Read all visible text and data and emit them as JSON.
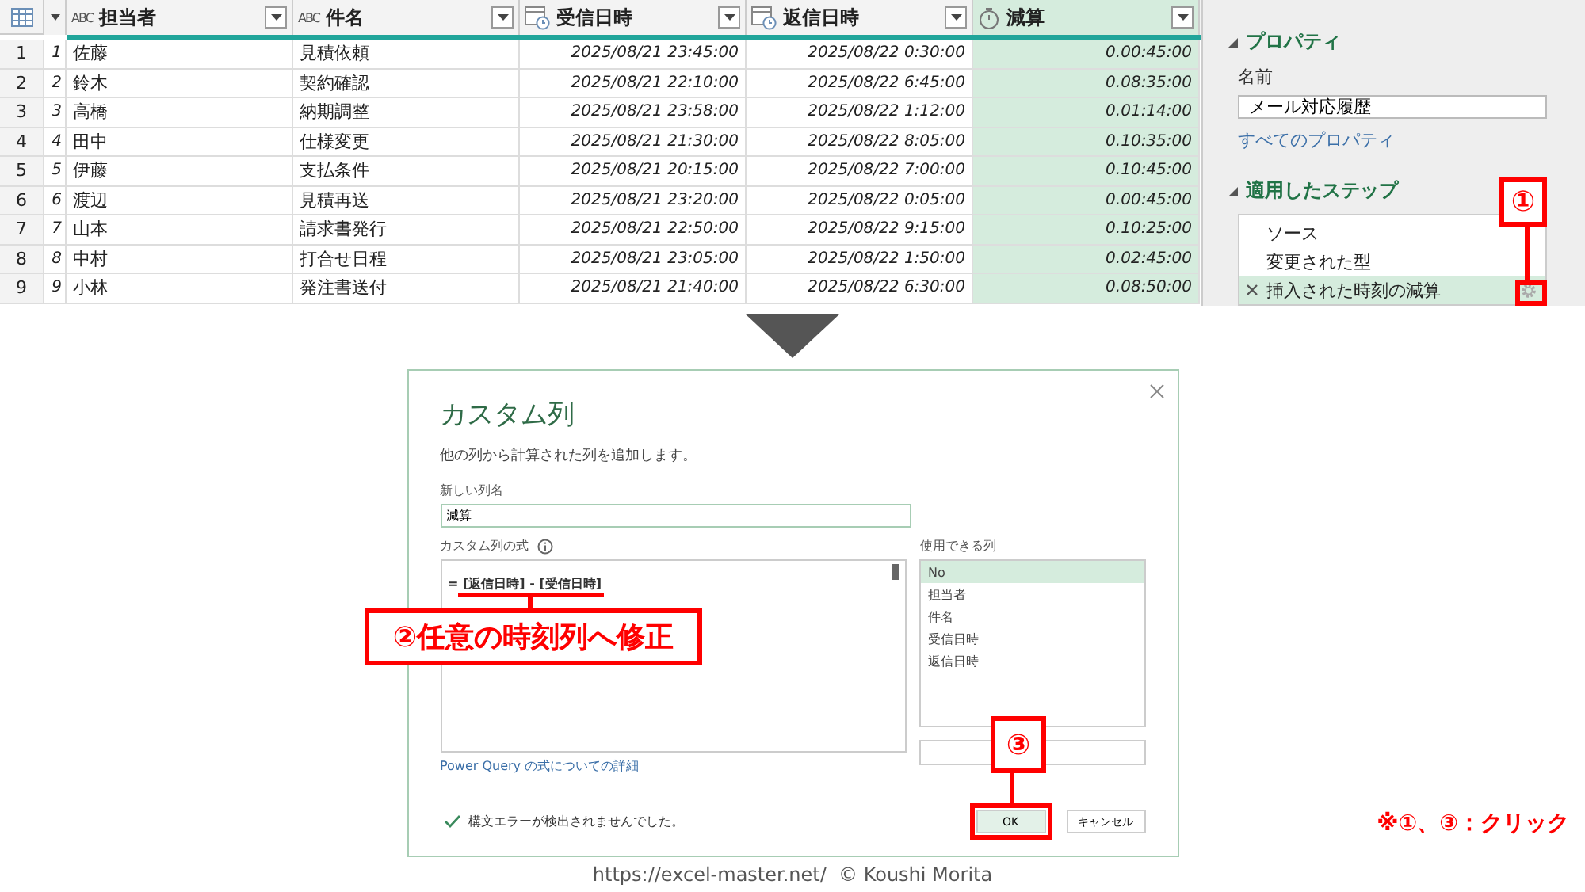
{
  "grid": {
    "columns": [
      {
        "kind": "text",
        "type_glyph": "ABC",
        "label": "担当者",
        "selected": false
      },
      {
        "kind": "text",
        "type_glyph": "ABC",
        "label": "件名",
        "selected": false
      },
      {
        "kind": "datetime",
        "label": "受信日時",
        "selected": false
      },
      {
        "kind": "datetime",
        "label": "返信日時",
        "selected": false
      },
      {
        "kind": "duration",
        "label": "減算",
        "selected": true
      }
    ],
    "rows": [
      {
        "row_number": "1",
        "index": "1",
        "cells": [
          "佐藤",
          "見積依頼",
          "2025/08/21 23:45:00",
          "2025/08/22 0:30:00",
          "0.00:45:00"
        ]
      },
      {
        "row_number": "2",
        "index": "2",
        "cells": [
          "鈴木",
          "契約確認",
          "2025/08/21 22:10:00",
          "2025/08/22 6:45:00",
          "0.08:35:00"
        ]
      },
      {
        "row_number": "3",
        "index": "3",
        "cells": [
          "高橋",
          "納期調整",
          "2025/08/21 23:58:00",
          "2025/08/22 1:12:00",
          "0.01:14:00"
        ]
      },
      {
        "row_number": "4",
        "index": "4",
        "cells": [
          "田中",
          "仕様変更",
          "2025/08/21 21:30:00",
          "2025/08/22 8:05:00",
          "0.10:35:00"
        ]
      },
      {
        "row_number": "5",
        "index": "5",
        "cells": [
          "伊藤",
          "支払条件",
          "2025/08/21 20:15:00",
          "2025/08/22 7:00:00",
          "0.10:45:00"
        ]
      },
      {
        "row_number": "6",
        "index": "6",
        "cells": [
          "渡辺",
          "見積再送",
          "2025/08/21 23:20:00",
          "2025/08/22 0:05:00",
          "0.00:45:00"
        ]
      },
      {
        "row_number": "7",
        "index": "7",
        "cells": [
          "山本",
          "請求書発行",
          "2025/08/21 22:50:00",
          "2025/08/22 9:15:00",
          "0.10:25:00"
        ]
      },
      {
        "row_number": "8",
        "index": "8",
        "cells": [
          "中村",
          "打合せ日程",
          "2025/08/21 23:05:00",
          "2025/08/22 1:50:00",
          "0.02:45:00"
        ]
      },
      {
        "row_number": "9",
        "index": "9",
        "cells": [
          "小林",
          "発注書送付",
          "2025/08/21 21:40:00",
          "2025/08/22 6:30:00",
          "0.08:50:00"
        ]
      }
    ]
  },
  "panel": {
    "properties_heading": "プロパティ",
    "name_label": "名前",
    "name_value": "メール対応履歴",
    "all_properties_link": "すべてのプロパティ",
    "steps_heading": "適用したステップ",
    "steps": [
      {
        "label": "ソース",
        "selected": false
      },
      {
        "label": "変更された型",
        "selected": false
      },
      {
        "label": "挿入された時刻の減算",
        "selected": true
      }
    ]
  },
  "dialog": {
    "title": "カスタム列",
    "subtitle": "他の列から計算された列を追加します。",
    "name_label": "新しい列名",
    "name_value": "減算",
    "formula_label": "カスタム列の式",
    "formula": "= [返信日時] - [受信日時]",
    "available_label": "使用できる列",
    "available_columns": [
      {
        "label": "No",
        "selected": true
      },
      {
        "label": "担当者",
        "selected": false
      },
      {
        "label": "件名",
        "selected": false
      },
      {
        "label": "受信日時",
        "selected": false
      },
      {
        "label": "返信日時",
        "selected": false
      }
    ],
    "help_link": "Power Query の式についての詳細",
    "status": "構文エラーが検出されませんでした。",
    "ok_button": "OK",
    "cancel_button": "キャンセル"
  },
  "annotations": {
    "gear_marker": "①",
    "formula_marker": "②任意の時刻列へ修正",
    "ok_marker": "③",
    "note": "※①、③：クリック"
  },
  "footer": "https://excel-master.net/  © Koushi Morita"
}
